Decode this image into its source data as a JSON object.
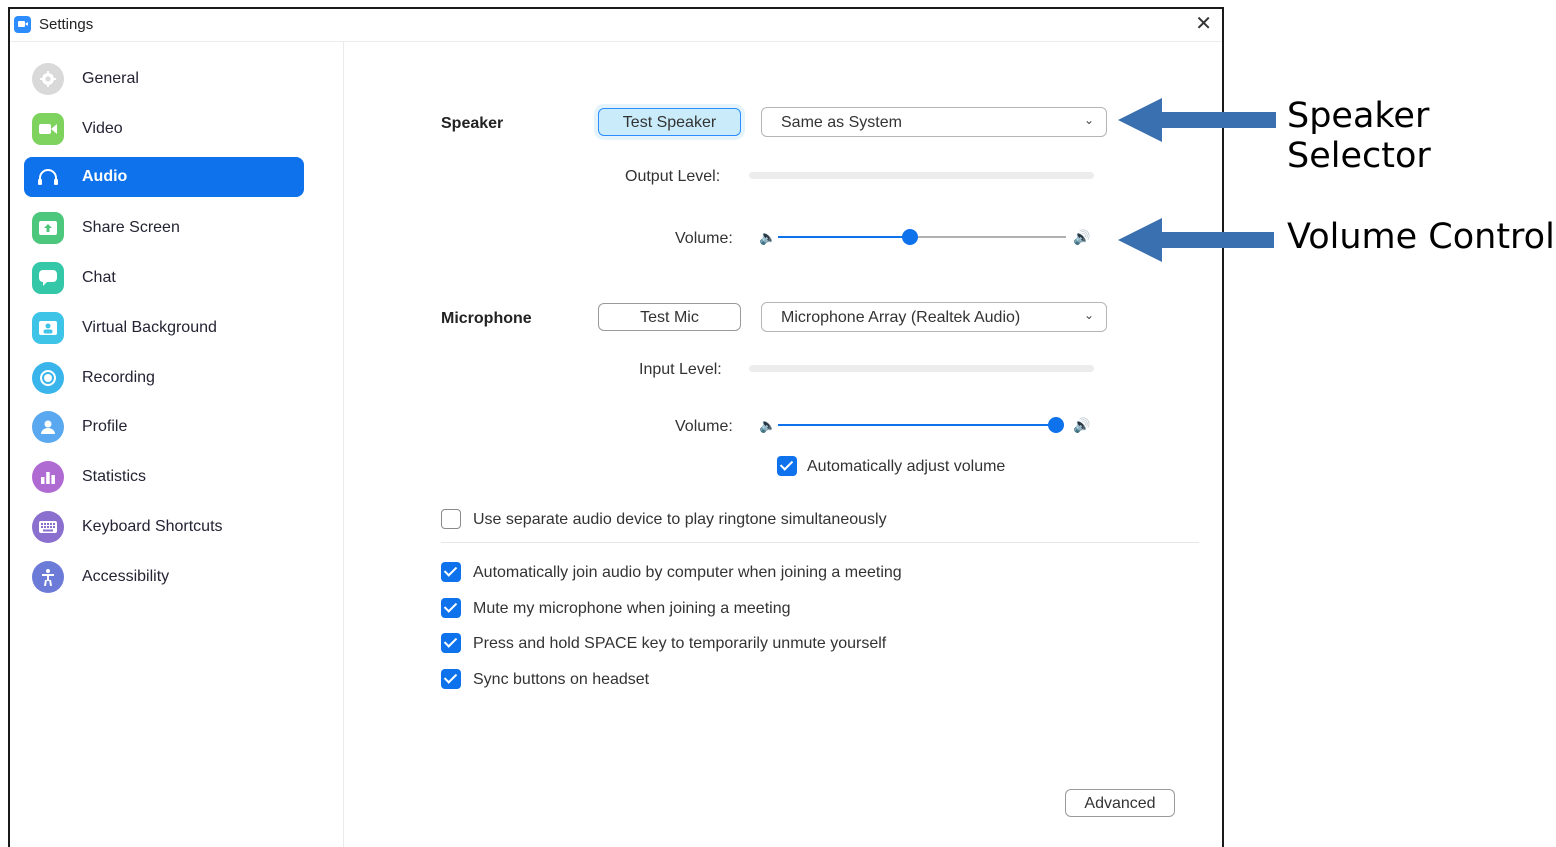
{
  "window": {
    "title": "Settings",
    "close_symbol": "✕"
  },
  "sidebar": {
    "items": [
      {
        "label": "General",
        "icon": "gear-icon",
        "color": "#d9d9d9"
      },
      {
        "label": "Video",
        "icon": "video-camera-icon",
        "color": "#7ed35f"
      },
      {
        "label": "Audio",
        "icon": "headphones-icon",
        "color": "#0e72ed",
        "active": true
      },
      {
        "label": "Share Screen",
        "icon": "share-screen-icon",
        "color": "#4cc77b"
      },
      {
        "label": "Chat",
        "icon": "chat-bubble-icon",
        "color": "#34c7a8"
      },
      {
        "label": "Virtual Background",
        "icon": "person-background-icon",
        "color": "#3ec4e6"
      },
      {
        "label": "Recording",
        "icon": "record-icon",
        "color": "#39b5ec"
      },
      {
        "label": "Profile",
        "icon": "user-icon",
        "color": "#5aa8f0"
      },
      {
        "label": "Statistics",
        "icon": "bar-chart-icon",
        "color": "#b06bd3"
      },
      {
        "label": "Keyboard Shortcuts",
        "icon": "keyboard-icon",
        "color": "#8a6fcf"
      },
      {
        "label": "Accessibility",
        "icon": "accessibility-icon",
        "color": "#6c7ad8"
      }
    ]
  },
  "speaker": {
    "section_label": "Speaker",
    "test_button": "Test Speaker",
    "device": "Same as System",
    "output_level_label": "Output Level:",
    "volume_label": "Volume:",
    "volume_fraction": 0.46
  },
  "microphone": {
    "section_label": "Microphone",
    "test_button": "Test Mic",
    "device": "Microphone Array (Realtek Audio)",
    "input_level_label": "Input Level:",
    "volume_label": "Volume:",
    "volume_fraction": 1.0,
    "auto_adjust_label": "Automatically adjust volume",
    "auto_adjust_checked": true
  },
  "options": {
    "separate_ringtone": {
      "label": "Use separate audio device to play ringtone simultaneously",
      "checked": false
    },
    "auto_join": {
      "label": "Automatically join audio by computer when joining a meeting",
      "checked": true
    },
    "mute_on_join": {
      "label": "Mute my microphone when joining a meeting",
      "checked": true
    },
    "space_unmute": {
      "label": "Press and hold SPACE key to temporarily unmute yourself",
      "checked": true
    },
    "sync_headset": {
      "label": "Sync buttons on headset",
      "checked": true
    }
  },
  "advanced_button": "Advanced",
  "annotations": {
    "speaker_selector": "Speaker Selector",
    "volume_control": "Volume Control",
    "arrow_color": "#3a6fb0"
  }
}
